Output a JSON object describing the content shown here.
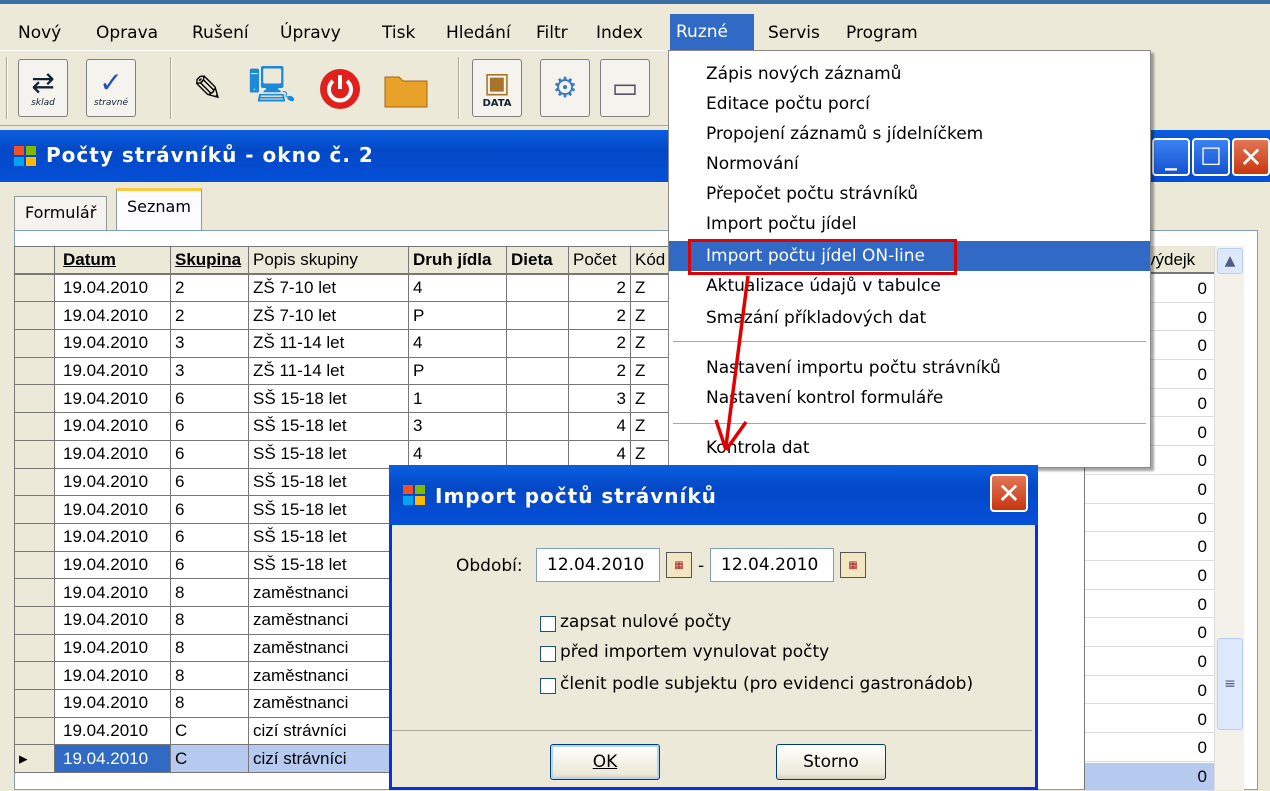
{
  "menubar": {
    "items": [
      "Nový",
      "Oprava",
      "Rušení",
      "Úpravy",
      "Tisk",
      "Hledání",
      "Filtr",
      "Index",
      "Ruzné",
      "Servis",
      "Program"
    ]
  },
  "toolbar": {
    "btn_sklad": "sklad",
    "btn_stravne": "stravné",
    "btn_data": "DATA"
  },
  "window": {
    "title": "Počty strávníků - okno č. 2",
    "tabs": [
      "Formulář",
      "Seznam"
    ]
  },
  "grid": {
    "headers": [
      "Datum",
      "Skupina",
      "Popis skupiny",
      "Druh jídla",
      "Dieta",
      "Počet",
      "Kód"
    ],
    "last_header": "výdejk",
    "rows": [
      [
        "19.04.2010",
        "2",
        "ZŠ 7-10 let",
        "4",
        "",
        "2",
        "Z",
        "0"
      ],
      [
        "19.04.2010",
        "2",
        "ZŠ 7-10 let",
        "P",
        "",
        "2",
        "Z",
        "0"
      ],
      [
        "19.04.2010",
        "3",
        "ZŠ 11-14 let",
        "4",
        "",
        "2",
        "Z",
        "0"
      ],
      [
        "19.04.2010",
        "3",
        "ZŠ 11-14 let",
        "P",
        "",
        "2",
        "Z",
        "0"
      ],
      [
        "19.04.2010",
        "6",
        "SŠ 15-18 let",
        "1",
        "",
        "3",
        "Z",
        "0"
      ],
      [
        "19.04.2010",
        "6",
        "SŠ 15-18 let",
        "3",
        "",
        "4",
        "Z",
        "0"
      ],
      [
        "19.04.2010",
        "6",
        "SŠ 15-18 let",
        "4",
        "",
        "4",
        "Z",
        "0"
      ],
      [
        "19.04.2010",
        "6",
        "SŠ 15-18 let",
        "",
        "",
        "",
        "",
        "0"
      ],
      [
        "19.04.2010",
        "6",
        "SŠ 15-18 let",
        "",
        "",
        "",
        "",
        "0"
      ],
      [
        "19.04.2010",
        "6",
        "SŠ 15-18 let",
        "",
        "",
        "",
        "",
        "0"
      ],
      [
        "19.04.2010",
        "6",
        "SŠ 15-18 let",
        "",
        "",
        "",
        "",
        "0"
      ],
      [
        "19.04.2010",
        "8",
        "zaměstnanci",
        "",
        "",
        "",
        "",
        "0"
      ],
      [
        "19.04.2010",
        "8",
        "zaměstnanci",
        "",
        "",
        "",
        "",
        "0"
      ],
      [
        "19.04.2010",
        "8",
        "zaměstnanci",
        "",
        "",
        "",
        "",
        "0"
      ],
      [
        "19.04.2010",
        "8",
        "zaměstnanci",
        "",
        "",
        "",
        "",
        "0"
      ],
      [
        "19.04.2010",
        "8",
        "zaměstnanci",
        "",
        "",
        "",
        "",
        "0"
      ],
      [
        "19.04.2010",
        "C",
        "cizí strávníci",
        "",
        "",
        "",
        "",
        "0"
      ],
      [
        "19.04.2010",
        "C",
        "cizí strávníci",
        "",
        "",
        "",
        "",
        "0"
      ]
    ]
  },
  "dropdown": {
    "items": [
      "Zápis nových záznamů",
      "Editace počtu porcí",
      "Propojení záznamů s jídelníčkem",
      "Normování",
      "Přepočet počtu strávníků",
      "Import počtu jídel",
      "Import počtu jídel ON-line",
      "Aktualizace údajů v tabulce",
      "Smazání příkladových dat",
      "Nastavení importu počtu strávníků",
      "Nastavení kontrol formuláře",
      "Kontrola dat"
    ],
    "highlighted_index": 6
  },
  "dialog": {
    "title": "Import počtů strávníků",
    "period_label": "Období:",
    "date_from": "12.04.2010",
    "date_sep": "-",
    "date_to": "12.04.2010",
    "checkboxes": [
      "zapsat nulové počty",
      "před importem vynulovat počty",
      "členit podle subjektu (pro evidenci gastronádob)"
    ],
    "ok_label": "OK",
    "cancel_label": "Storno"
  },
  "colors": {
    "title_blue": "#0348c6",
    "highlight": "#316ac5",
    "annotation_red": "#e00000"
  }
}
